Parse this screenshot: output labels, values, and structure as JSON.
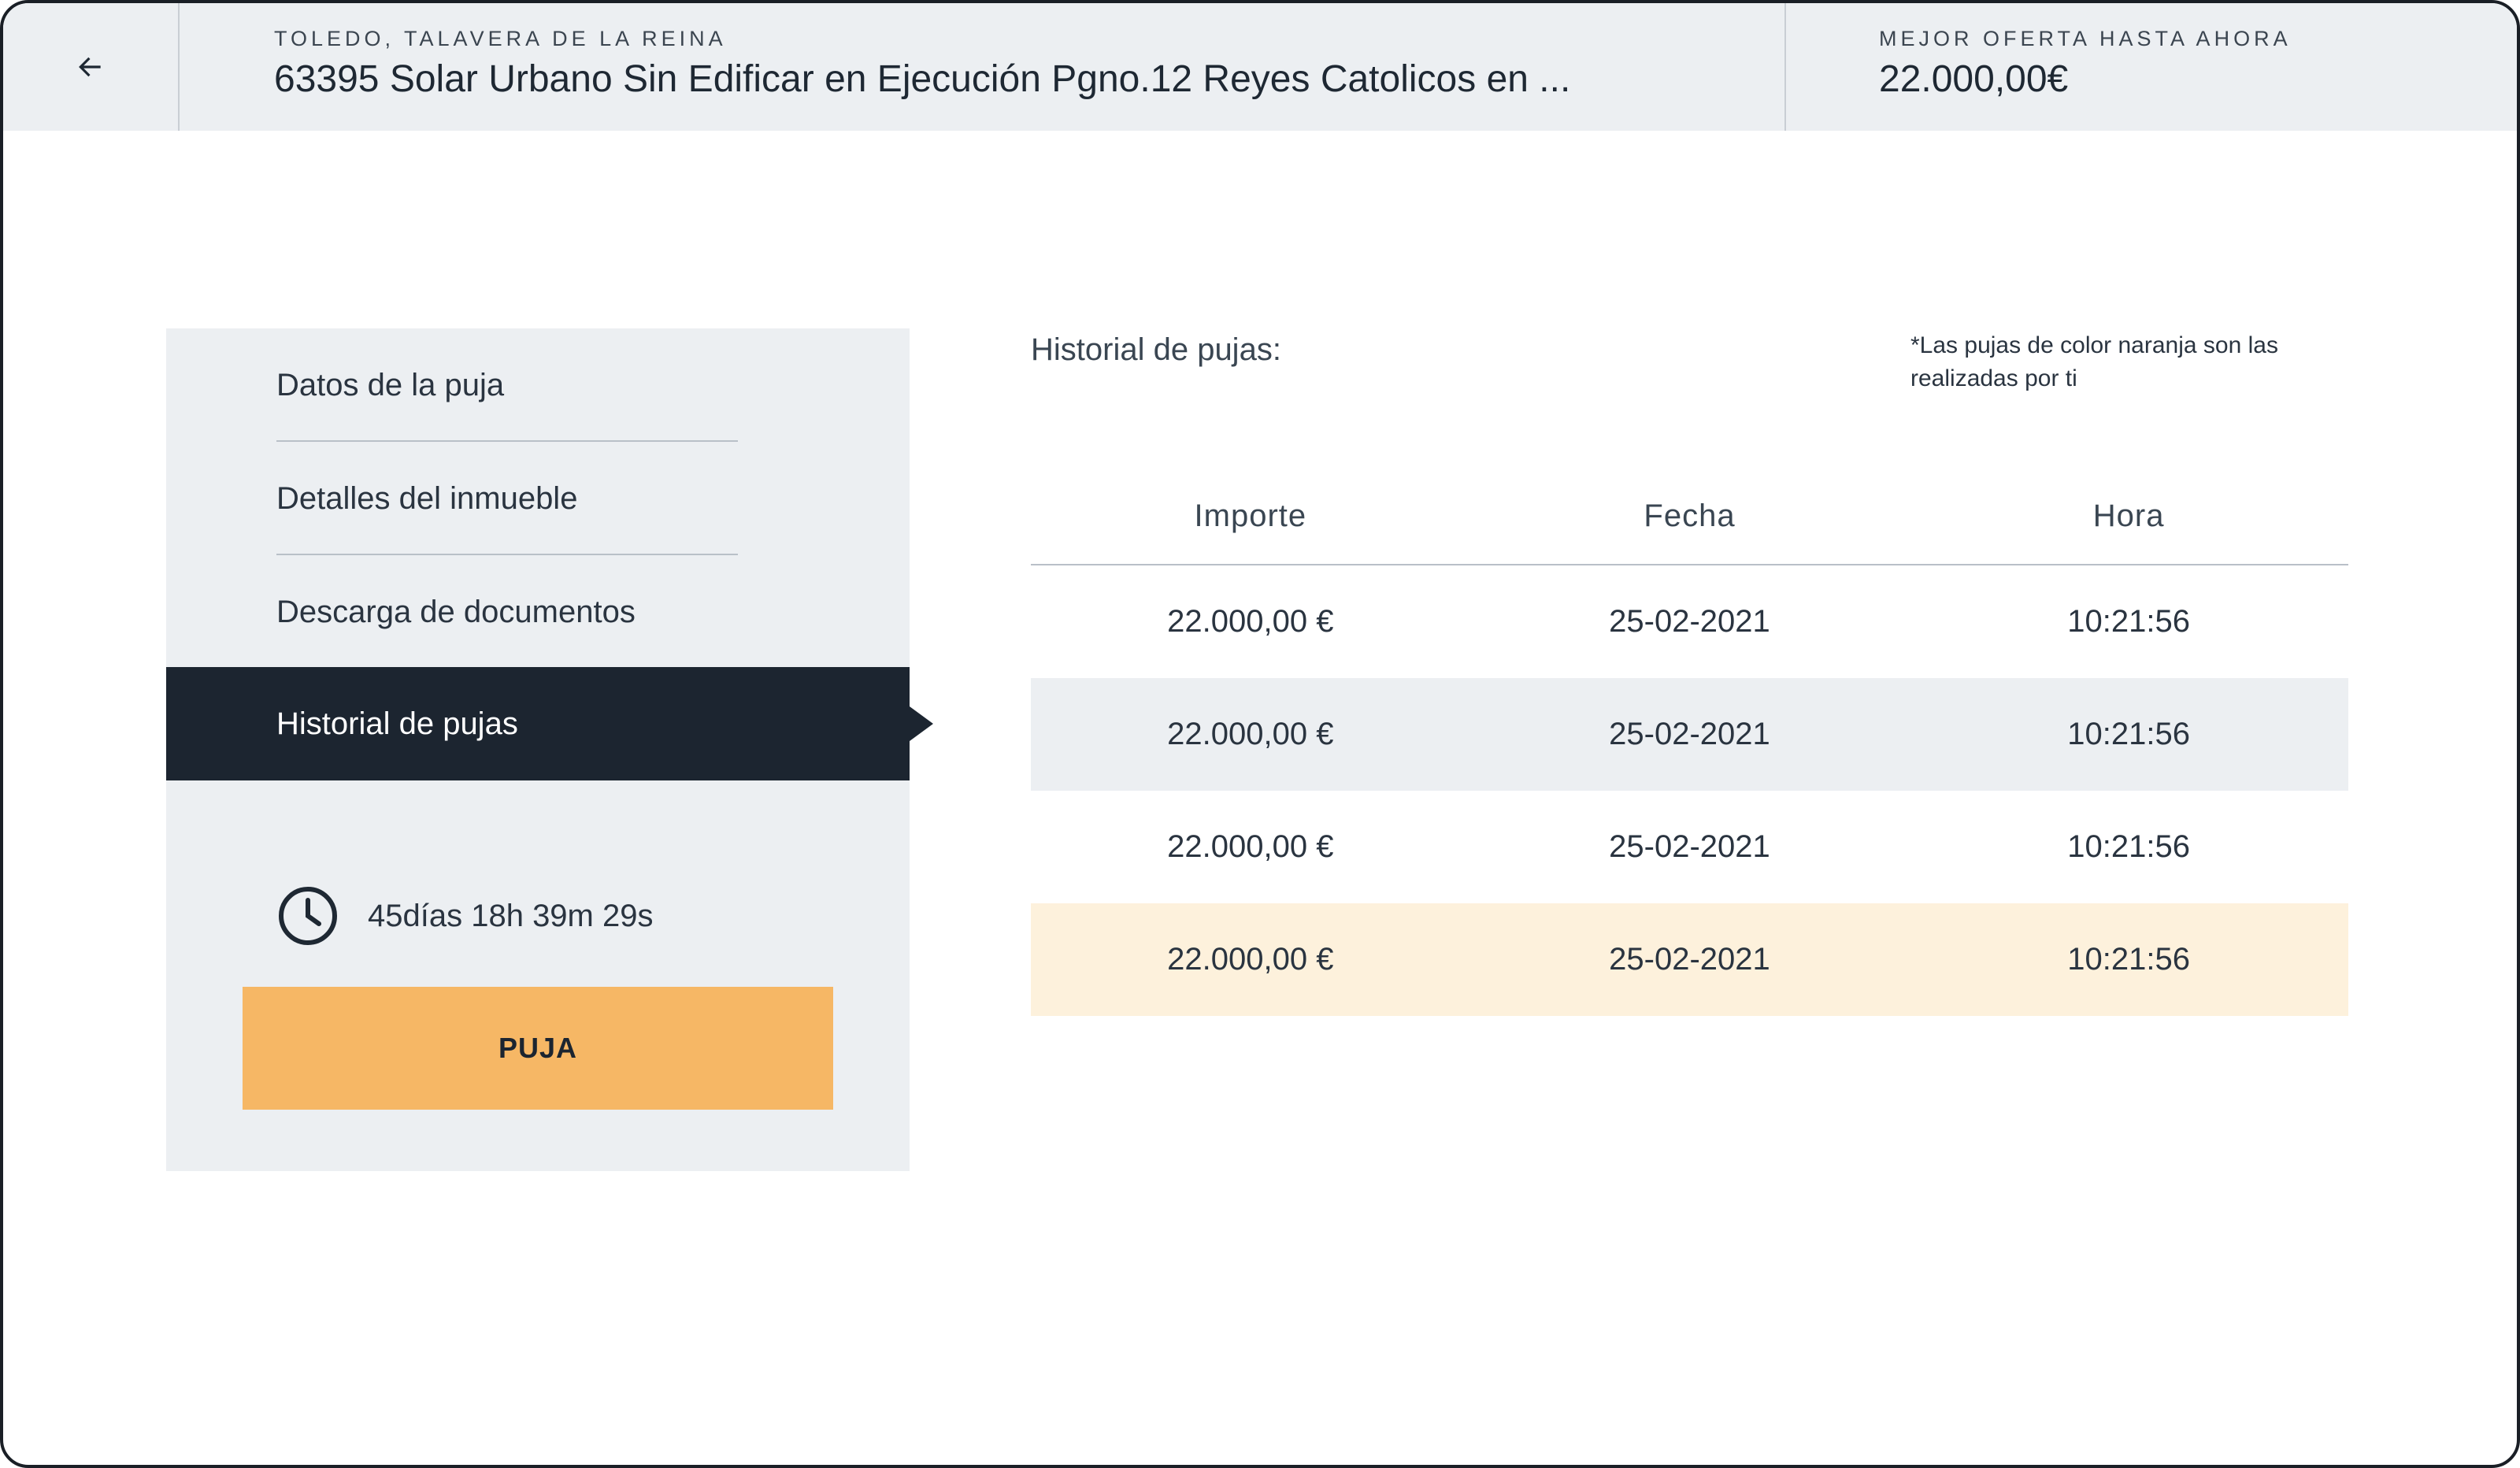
{
  "header": {
    "location": "TOLEDO, TALAVERA DE LA REINA",
    "title": "63395 Solar Urbano Sin Edificar en Ejecución Pgno.12 Reyes Catolicos en ...",
    "offer_label": "MEJOR OFERTA HASTA AHORA",
    "offer_value": "22.000,00€"
  },
  "sidebar": {
    "items": [
      {
        "label": "Datos de la puja",
        "active": false
      },
      {
        "label": "Detalles del inmueble",
        "active": false
      },
      {
        "label": "Descarga de documentos",
        "active": false
      },
      {
        "label": "Historial de pujas",
        "active": true
      }
    ],
    "countdown": "45días 18h 39m 29s",
    "bid_button": "PUJA"
  },
  "history": {
    "title": "Historial de pujas:",
    "note": "*Las pujas de color naranja son las realizadas por ti",
    "columns": [
      "Importe",
      "Fecha",
      "Hora"
    ],
    "rows": [
      {
        "importe": "22.000,00 €",
        "fecha": "25-02-2021",
        "hora": "10:21:56",
        "style": "plain"
      },
      {
        "importe": "22.000,00 €",
        "fecha": "25-02-2021",
        "hora": "10:21:56",
        "style": "shade"
      },
      {
        "importe": "22.000,00 €",
        "fecha": "25-02-2021",
        "hora": "10:21:56",
        "style": "plain"
      },
      {
        "importe": "22.000,00 €",
        "fecha": "25-02-2021",
        "hora": "10:21:56",
        "style": "mine"
      }
    ]
  },
  "colors": {
    "header_bg": "#eceff2",
    "active_bg": "#1c2530",
    "accent_orange": "#f6b765",
    "own_bid_row": "#fdf1dc"
  },
  "icons": {
    "back": "arrow-left-icon",
    "clock": "clock-icon"
  }
}
